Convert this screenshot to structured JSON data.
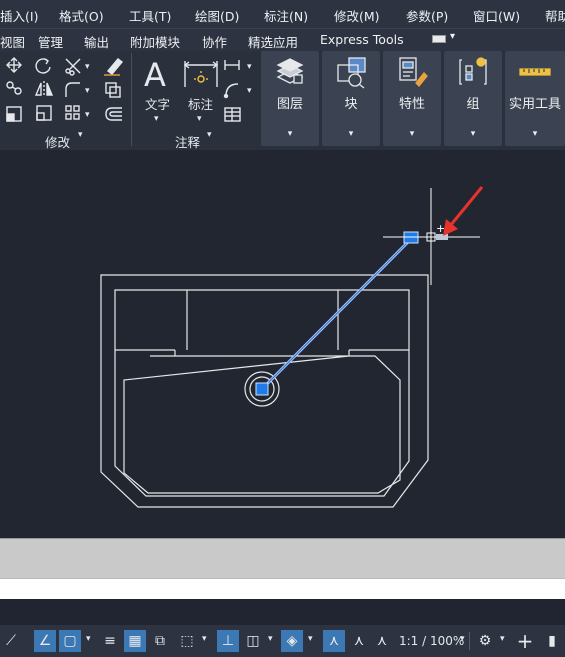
{
  "menubar": {
    "items": [
      "插入(I)",
      "格式(O)",
      "工具(T)",
      "绘图(D)",
      "标注(N)",
      "修改(M)",
      "参数(P)",
      "窗口(W)",
      "帮助"
    ]
  },
  "ribbon_tabs": {
    "items": [
      "视图",
      "管理",
      "输出",
      "附加模块",
      "协作",
      "精选应用",
      "Express Tools"
    ]
  },
  "ribbon": {
    "modify_panel": "修改",
    "annotation_panel": "注释",
    "text_label": "文字",
    "dimension_label": "标注",
    "layers_label": "图层",
    "block_label": "块",
    "properties_label": "特性",
    "group_label": "组",
    "utilities_label": "实用工具"
  },
  "statusbar": {
    "scale": "1:1 / 100%"
  },
  "colors": {
    "background": "#212631",
    "ribbon": "#2a303c",
    "accent": "#3c78b4",
    "grip": "#1e7be8",
    "arrow": "#e8332c"
  },
  "icons": {
    "move": "move-icon",
    "rotate": "rotate-icon",
    "trim": "trim-icon",
    "erase": "erase-icon",
    "copy": "copy-icon",
    "mirror": "mirror-icon",
    "fillet": "fillet-icon",
    "explode": "explode-icon",
    "stretch": "stretch-icon",
    "scale": "scale-icon",
    "array": "array-icon",
    "offset": "offset-icon",
    "gear": "gear-icon"
  }
}
